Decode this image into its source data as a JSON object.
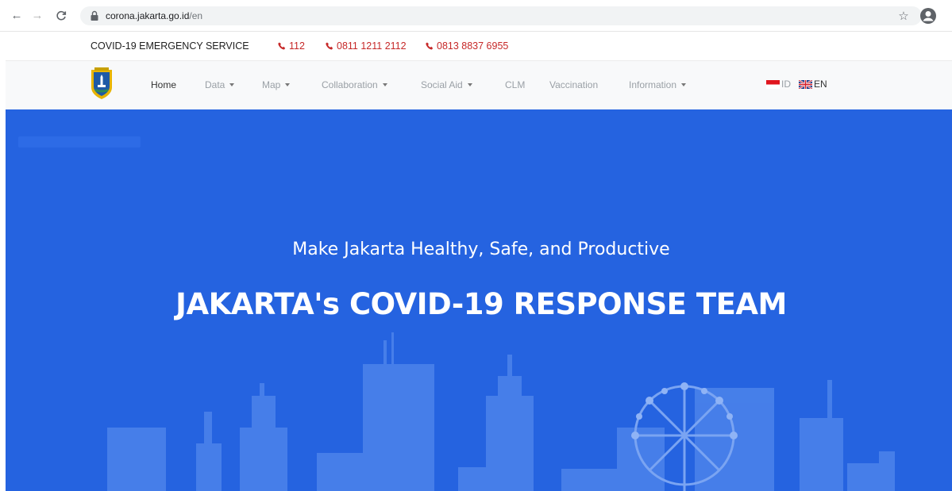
{
  "browser": {
    "url_host": "corona.jakarta.go.id",
    "url_path": "/en",
    "icons": [
      "back-icon",
      "forward-icon",
      "reload-icon",
      "lock-icon",
      "star-icon",
      "profile-icon"
    ]
  },
  "emergency": {
    "label": "COVID-19 EMERGENCY SERVICE",
    "phones": [
      "112",
      "0811 1211 2112",
      "0813 8837 6955"
    ],
    "phone_color": "#c62828"
  },
  "navbar": {
    "items": [
      {
        "label": "Home",
        "dropdown": false,
        "active": true
      },
      {
        "label": "Data",
        "dropdown": true
      },
      {
        "label": "Map",
        "dropdown": true
      },
      {
        "label": "Collaboration",
        "dropdown": true
      },
      {
        "label": "Social Aid",
        "dropdown": true
      },
      {
        "label": "CLM",
        "dropdown": false
      },
      {
        "label": "Vaccination",
        "dropdown": false
      },
      {
        "label": "Information",
        "dropdown": true
      }
    ],
    "languages": [
      {
        "code": "ID",
        "flag": "indonesia-flag-icon"
      },
      {
        "code": "EN",
        "flag": "uk-flag-icon"
      }
    ]
  },
  "hero": {
    "tagline": "Make Jakarta Healthy, Safe, and Productive",
    "title": "JAKARTA's COVID-19 RESPONSE TEAM",
    "background_color": "#2563e0"
  }
}
